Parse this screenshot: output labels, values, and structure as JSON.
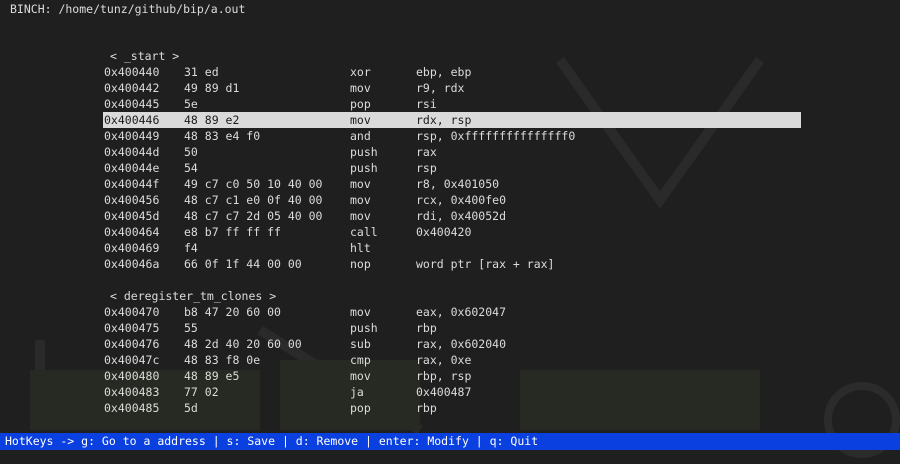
{
  "window": {
    "title": "BINCH: /home/tunz/github/bip/a.out"
  },
  "sections": [
    {
      "label": "< _start >",
      "rows": [
        {
          "addr": "0x400440",
          "bytes": "31 ed",
          "mnem": "xor",
          "ops": "ebp, ebp"
        },
        {
          "addr": "0x400442",
          "bytes": "49 89 d1",
          "mnem": "mov",
          "ops": "r9, rdx"
        },
        {
          "addr": "0x400445",
          "bytes": "5e",
          "mnem": "pop",
          "ops": "rsi"
        },
        {
          "addr": "0x400446",
          "bytes": "48 89 e2",
          "mnem": "mov",
          "ops": "rdx, rsp",
          "selected": true
        },
        {
          "addr": "0x400449",
          "bytes": "48 83 e4 f0",
          "mnem": "and",
          "ops": "rsp, 0xfffffffffffffff0"
        },
        {
          "addr": "0x40044d",
          "bytes": "50",
          "mnem": "push",
          "ops": "rax"
        },
        {
          "addr": "0x40044e",
          "bytes": "54",
          "mnem": "push",
          "ops": "rsp"
        },
        {
          "addr": "0x40044f",
          "bytes": "49 c7 c0 50 10 40 00",
          "mnem": "mov",
          "ops": "r8, 0x401050"
        },
        {
          "addr": "0x400456",
          "bytes": "48 c7 c1 e0 0f 40 00",
          "mnem": "mov",
          "ops": "rcx, 0x400fe0"
        },
        {
          "addr": "0x40045d",
          "bytes": "48 c7 c7 2d 05 40 00",
          "mnem": "mov",
          "ops": "rdi, 0x40052d"
        },
        {
          "addr": "0x400464",
          "bytes": "e8 b7 ff ff ff",
          "mnem": "call",
          "ops": "0x400420"
        },
        {
          "addr": "0x400469",
          "bytes": "f4",
          "mnem": "hlt",
          "ops": ""
        },
        {
          "addr": "0x40046a",
          "bytes": "66 0f 1f 44 00 00",
          "mnem": "nop",
          "ops": "word ptr [rax + rax]"
        }
      ]
    },
    {
      "label": "< deregister_tm_clones >",
      "rows": [
        {
          "addr": "0x400470",
          "bytes": "b8 47 20 60 00",
          "mnem": "mov",
          "ops": "eax, 0x602047"
        },
        {
          "addr": "0x400475",
          "bytes": "55",
          "mnem": "push",
          "ops": "rbp"
        },
        {
          "addr": "0x400476",
          "bytes": "48 2d 40 20 60 00",
          "mnem": "sub",
          "ops": "rax, 0x602040"
        },
        {
          "addr": "0x40047c",
          "bytes": "48 83 f8 0e",
          "mnem": "cmp",
          "ops": "rax, 0xe"
        },
        {
          "addr": "0x400480",
          "bytes": "48 89 e5",
          "mnem": "mov",
          "ops": "rbp, rsp"
        },
        {
          "addr": "0x400483",
          "bytes": "77 02",
          "mnem": "ja",
          "ops": "0x400487"
        },
        {
          "addr": "0x400485",
          "bytes": "5d",
          "mnem": "pop",
          "ops": "rbp"
        }
      ]
    }
  ],
  "statusbar": {
    "hotkeys": "HotKeys -> g: Go to a address | s: Save | d: Remove | enter: Modify | q: Quit"
  },
  "colors": {
    "background": "#1f1f1f",
    "text": "#dcdcdc",
    "selection": "#dadada",
    "statusbar": "#0a3fe0"
  }
}
